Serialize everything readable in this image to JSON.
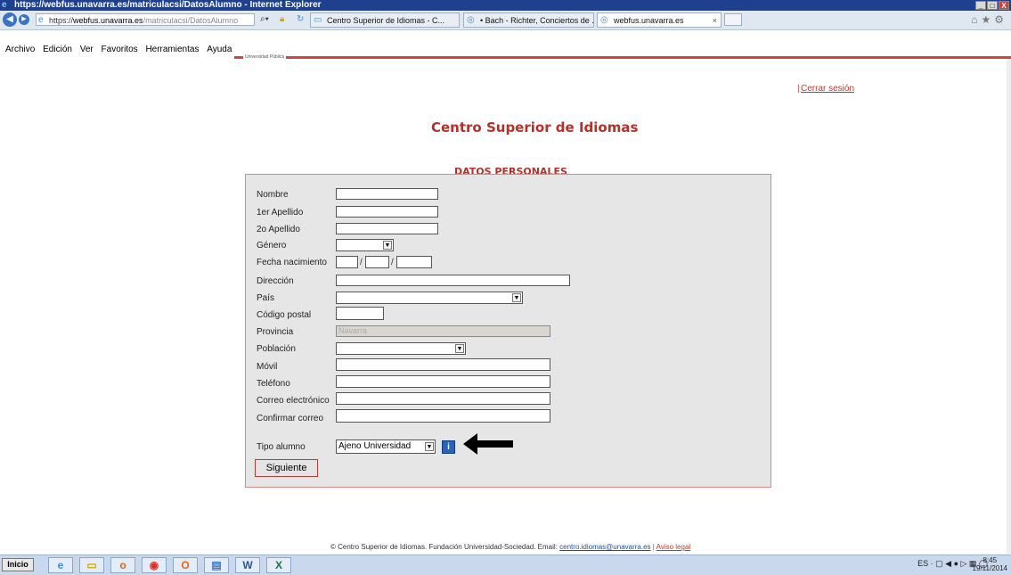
{
  "window": {
    "title": "https://webfus.unavarra.es/matriculacsi/DatosAlumno - Internet Explorer",
    "controls": [
      "_",
      "□",
      "X"
    ]
  },
  "addressbar": {
    "prefix": "https://",
    "host": "webfus.unavarra.es",
    "path": "/matriculacsi/DatosAlumno"
  },
  "tabs": [
    {
      "label": "Centro Superior de Idiomas - C..."
    },
    {
      "label": "• Bach - Richter, Conciertos de ..."
    },
    {
      "label": "webfus.unavarra.es",
      "close": "×"
    }
  ],
  "menu": [
    "Archivo",
    "Edición",
    "Ver",
    "Favoritos",
    "Herramientas",
    "Ayuda"
  ],
  "page": {
    "logo_caption": "Universidad Pública",
    "logout": "Cerrar sesión",
    "logout_sep": "|",
    "heading": "Centro Superior de Idiomas",
    "subheading": "DATOS PERSONALES"
  },
  "form": {
    "labels": {
      "nombre": "Nombre",
      "apellido1": "1er Apellido",
      "apellido2": "2o Apellido",
      "genero": "Género",
      "fecha": "Fecha nacimiento",
      "direccion": "Dirección",
      "pais": "País",
      "cp": "Código postal",
      "provincia": "Provincia",
      "poblacion": "Población",
      "movil": "Móvil",
      "telefono": "Teléfono",
      "correo": "Correo electrónico",
      "confirmar": "Confirmar correo",
      "tipo": "Tipo alumno"
    },
    "values": {
      "provincia": "Navarra",
      "tipo": "Ajeno Universidad",
      "date_sep": "/"
    },
    "info_icon": "i",
    "next_label": "Siguiente"
  },
  "footer": {
    "text": "© Centro Superior de Idiomas. Fundación Universidad-Sociedad. Email:",
    "email": "centro.idiomas@unavarra.es",
    "sep": "|",
    "legal": "Aviso legal"
  },
  "taskbar": {
    "start": "Inicio",
    "apps": [
      "e",
      "▭",
      "o",
      "◉",
      "O",
      "▤",
      "W",
      "X"
    ],
    "lang": "ES",
    "time": "8:45",
    "date": "19/11/2014"
  }
}
